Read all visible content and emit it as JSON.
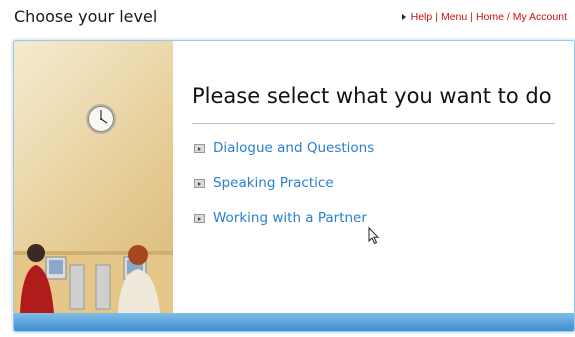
{
  "header": {
    "title": "Choose your level",
    "links": [
      "Help",
      "Menu",
      "Home / My Account"
    ],
    "separator": "|"
  },
  "main": {
    "heading": "Please select what you want to do",
    "options": [
      "Dialogue and Questions",
      "Speaking Practice",
      "Working with a Partner"
    ]
  },
  "colors": {
    "link_red": "#c81010",
    "option_blue": "#2a7fd0",
    "frame_blue": "#3f8fd0"
  }
}
